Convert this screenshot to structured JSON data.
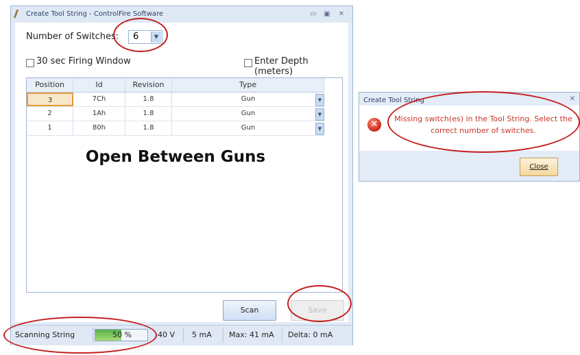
{
  "window": {
    "title": "Create Tool String - ControlFire Software",
    "min_glyph": "▭",
    "max_glyph": "▣",
    "close_glyph": "✕"
  },
  "form": {
    "switches_label": "Number of Switches:",
    "switches_value": "6",
    "firing_window_label": "30 sec Firing Window",
    "depth_label": "Enter Depth (meters)"
  },
  "grid": {
    "columns": [
      "Position",
      "Id",
      "Revision",
      "Type"
    ],
    "rows": [
      {
        "position": "3",
        "id": "7Ch",
        "revision": "1.8",
        "type": "Gun"
      },
      {
        "position": "2",
        "id": "1Ah",
        "revision": "1.8",
        "type": "Gun"
      },
      {
        "position": "1",
        "id": "80h",
        "revision": "1.8",
        "type": "Gun"
      }
    ],
    "overlay_text": "Open Between Guns"
  },
  "buttons": {
    "scan": "Scan",
    "save": "Save"
  },
  "status": {
    "state": "Scanning String",
    "progress_text": "50 %",
    "progress": 0.5,
    "voltage": "40 V",
    "current": "5 mA",
    "max": "Max: 41 mA",
    "delta": "Delta: 0 mA"
  },
  "dialog": {
    "title": "Create Tool String",
    "close_glyph": "✕",
    "message": "Missing switch(es) in the Tool String. Select the correct number of switches.",
    "close_button": "Close"
  },
  "colors": {
    "annotation": "#c31f1f",
    "error": "#c8342a",
    "accent": "#dfe9f6"
  },
  "icons": [
    "tool-string-app-icon",
    "dropdown-arrow-icon",
    "error-icon",
    "checkbox-icon"
  ]
}
